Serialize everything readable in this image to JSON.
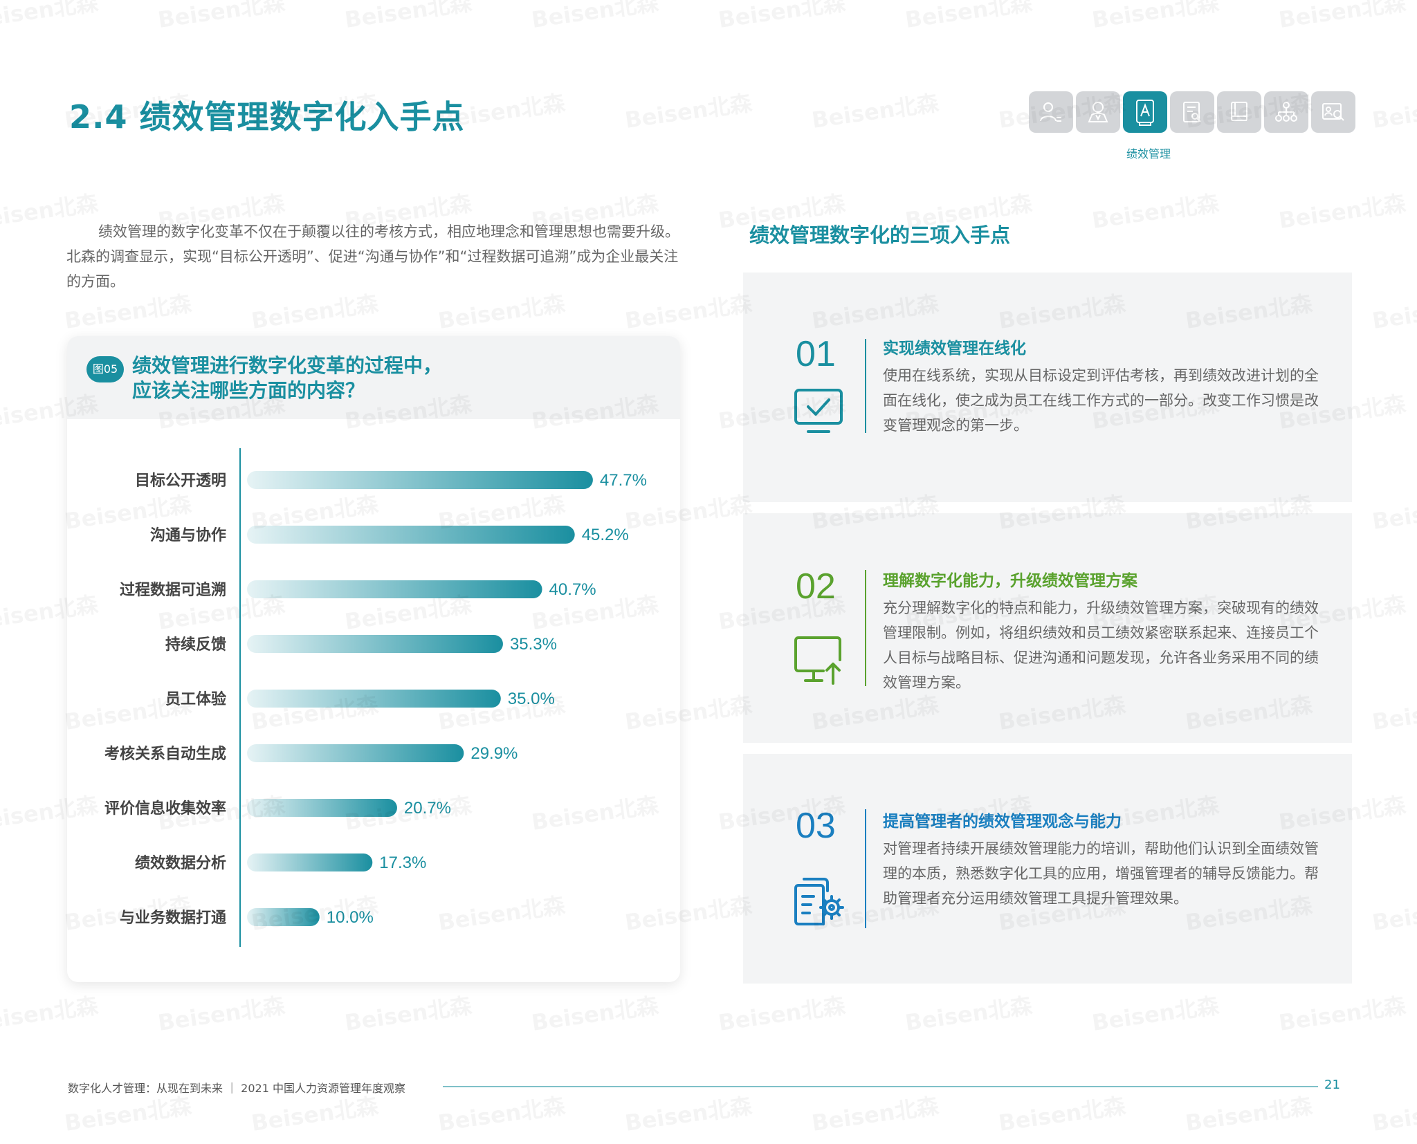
{
  "page": {
    "title": "2.4 绩效管理数字化入手点",
    "nav": {
      "icons": [
        "person-list-icon",
        "person-icon",
        "performance-icon",
        "document-edit-icon",
        "book-icon",
        "org-chart-icon",
        "profile-search-icon"
      ],
      "active_label": "绩效管理"
    },
    "intro": "绩效管理的数字化变革不仅在于颠覆以往的考核方式，相应地理念和管理思想也需要升级。北森的调查显示，实现“目标公开透明”、促进“沟通与协作”和“过程数据可追溯”成为企业最关注的方面。",
    "figure": {
      "badge": "图05",
      "title_line1": "绩效管理进行数字化变革的过程中，",
      "title_line2": "应该关注哪些方面的内容？"
    },
    "right_heading": "绩效管理数字化的三项入手点",
    "points": [
      {
        "num": "01",
        "title": "实现绩效管理在线化",
        "body": "使用在线系统，实现从目标设定到评估考核，再到绩效改进计划的全面在线化，使之成为员工在线工作方式的一部分。改变工作习惯是改变管理观念的第一步。",
        "icon": "monitor-check-icon",
        "color": "#1a8fa0"
      },
      {
        "num": "02",
        "title": "理解数字化能力，升级绩效管理方案",
        "body": "充分理解数字化的特点和能力，升级绩效管理方案，突破现有的绩效管理限制。例如，将组织绩效和员工绩效紧密联系起来、连接员工个人目标与战略目标、促进沟通和问题发现，允许各业务采用不同的绩效管理方案。",
        "icon": "monitor-upload-icon",
        "color": "#5aa22e"
      },
      {
        "num": "03",
        "title": "提高管理者的绩效管理观念与能力",
        "body": "对管理者持续开展绩效管理能力的培训，帮助他们认识到全面绩效管理的本质，熟悉数字化工具的应用，增强管理者的辅导反馈能力。帮助管理者充分运用绩效管理工具提升管理效果。",
        "icon": "document-gear-icon",
        "color": "#1a7fc0"
      }
    ],
    "footer": {
      "text": "数字化人才管理：从现在到未来 ｜ 2021 中国人力资源管理年度观察",
      "page_number": "21"
    },
    "watermark": "Beisen北森"
  },
  "chart_data": {
    "type": "bar",
    "orientation": "horizontal",
    "categories": [
      "目标公开透明",
      "沟通与协作",
      "过程数据可追溯",
      "持续反馈",
      "员工体验",
      "考核关系自动生成",
      "评价信息收集效率",
      "绩效数据分析",
      "与业务数据打通"
    ],
    "values": [
      47.7,
      45.2,
      40.7,
      35.3,
      35.0,
      29.9,
      20.7,
      17.3,
      10.0
    ],
    "value_labels": [
      "47.7%",
      "45.2%",
      "40.7%",
      "35.3%",
      "35.0%",
      "29.9%",
      "20.7%",
      "17.3%",
      "10.0%"
    ],
    "xlim": [
      0,
      50
    ],
    "grid": false,
    "legend": "none",
    "colors": {
      "bar_start": "#e6f3f5",
      "bar_end": "#1a8fa0",
      "label": "#1a8fa0",
      "category": "#444444",
      "axis": "#1a8fa0"
    }
  }
}
